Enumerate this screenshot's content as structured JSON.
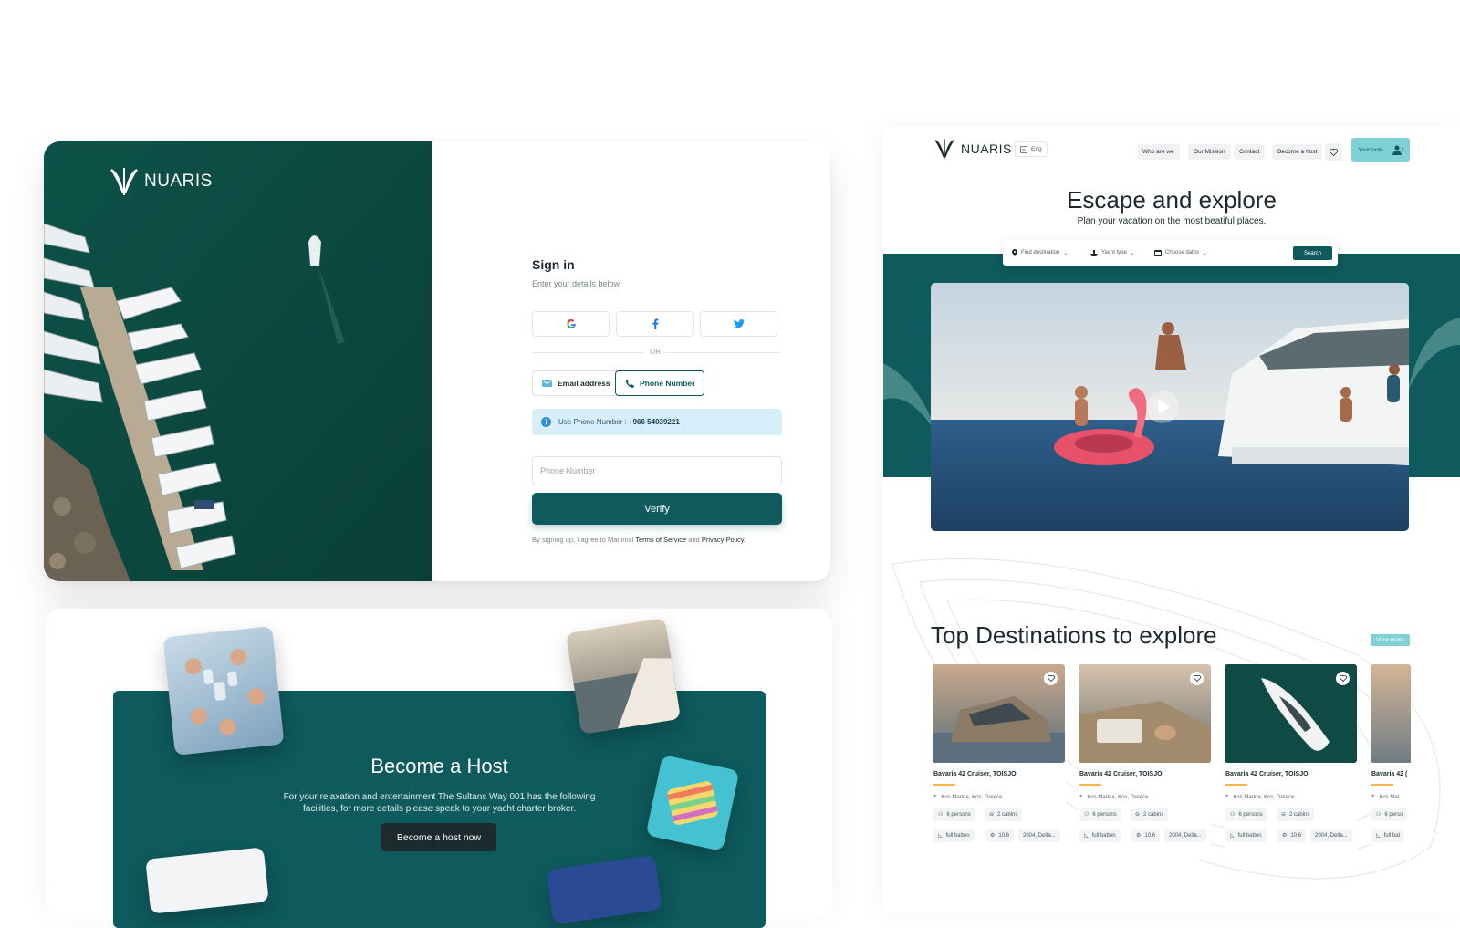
{
  "colors": {
    "brand_teal": "#0e5a5c",
    "accent_light_teal": "#7fd1d6",
    "info_bg": "#d6effa",
    "underline_gold": "#f2b443"
  },
  "signin": {
    "logo": "NUARIS",
    "title": "Sign in",
    "subtitle": "Enter your details below",
    "social": [
      "google-icon",
      "facebook-icon",
      "twitter-icon"
    ],
    "or_label": "OR",
    "tabs": {
      "email": "Email address",
      "phone": "Phone Number"
    },
    "info_prefix": "Use Phone Number : ",
    "info_number": "+966 54039221",
    "phone_placeholder": "Phone Number",
    "verify_label": "Verify",
    "terms_prefix": "By signing up, I agree to Manimal",
    "terms_link": "Terms of Service",
    "terms_and": "and",
    "privacy_link": "Privacy Policy."
  },
  "host": {
    "title": "Become a Host",
    "description": "For your relaxation and entertainment The Sultans Way 001 has the following facilities, for more details please speak to your yacht charter broker.",
    "button": "Become a host now"
  },
  "landing": {
    "logo": "NUARIS",
    "language": "Eng",
    "nav": [
      "Who are we",
      "Our Mission",
      "Contact",
      "Become a host"
    ],
    "cta": "Your note",
    "hero_title": "Escape and explore",
    "hero_subtitle": "Plan your vacation on the most beatiful places.",
    "search": {
      "destination": "Find destination",
      "yacht_type": "Yacht type",
      "dates": "Choose dates",
      "button": "Search"
    },
    "section_title": "Top Destinations to explore",
    "view_more": "View more",
    "cards": [
      {
        "name": "Bavaria 42 Cruiser, TOISJO",
        "location": "Kos Marina, Kos, Greece",
        "persons": "6 persons",
        "cabins": "2 cabins",
        "battens": "full batten",
        "length": "10.6",
        "year": "2004, Delta..."
      },
      {
        "name": "Bavaria 42 Cruiser, TOISJO",
        "location": "Kos Marina, Kos, Greece",
        "persons": "6 persons",
        "cabins": "2 cabins",
        "battens": "full batten",
        "length": "10.6",
        "year": "2004, Delta..."
      },
      {
        "name": "Bavaria 42 Cruiser, TOISJO",
        "location": "Kos Marina, Kos, Greece",
        "persons": "6 persons",
        "cabins": "2 cabins",
        "battens": "full batten",
        "length": "10.6",
        "year": "2004, Delta..."
      },
      {
        "name": "Bavaria 42 (",
        "location": "Kos Mar",
        "persons": "6 perso",
        "battens": "full bat"
      }
    ]
  }
}
